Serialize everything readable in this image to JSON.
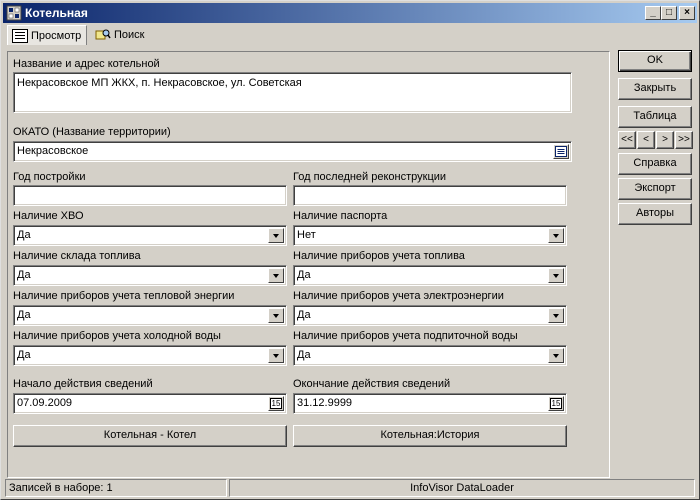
{
  "window": {
    "title": "Котельная",
    "minimize": "_",
    "maximize": "□",
    "close": "×"
  },
  "tabs": [
    {
      "label": "Просмотр",
      "icon": "view-list-icon",
      "active": true
    },
    {
      "label": "Поиск",
      "icon": "search-icon",
      "active": false
    }
  ],
  "form": {
    "name": {
      "label": "Название и адрес котельной",
      "value": "Некрасовское МП ЖКХ, п. Некрасовское, ул. Советская"
    },
    "okato": {
      "label": "ОКАТО (Название территории)",
      "value": "Некрасовское"
    },
    "year_built": {
      "label": "Год постройки",
      "value": ""
    },
    "year_reconstructed": {
      "label": "Год последней реконструкции",
      "value": ""
    },
    "hvo": {
      "label": "Наличие ХВО",
      "value": "Да"
    },
    "passport": {
      "label": "Наличие паспорта",
      "value": "Нет"
    },
    "fuel_storage": {
      "label": "Наличие склада топлива",
      "value": "Да"
    },
    "fuel_meters": {
      "label": "Наличие приборов учета топлива",
      "value": "Да"
    },
    "heat_meters": {
      "label": "Наличие приборов учета тепловой энергии",
      "value": "Да"
    },
    "power_meters": {
      "label": "Наличие приборов учета электроэнергии",
      "value": "Да"
    },
    "cold_water_meters": {
      "label": "Наличие приборов учета холодной воды",
      "value": "Да"
    },
    "makeup_water_meters": {
      "label": "Наличие приборов учета подпиточной воды",
      "value": "Да"
    },
    "date_start": {
      "label": "Начало действия сведений",
      "value": "07.09.2009",
      "btn": "15"
    },
    "date_end": {
      "label": "Окончание действия сведений",
      "value": "31.12.9999",
      "btn": "15"
    }
  },
  "subforms": {
    "boiler": "Котельная - Котел",
    "history": "Котельная:История"
  },
  "side": {
    "ok": "OK",
    "close": "Закрыть",
    "table": "Таблица",
    "nav": {
      "first": "<<",
      "prev": "<",
      "next": ">",
      "last": ">>"
    },
    "help": "Справка",
    "export": "Экспорт",
    "authors": "Авторы"
  },
  "status": {
    "records": "Записей в наборе: 1",
    "app": "InfoVisor DataLoader"
  }
}
